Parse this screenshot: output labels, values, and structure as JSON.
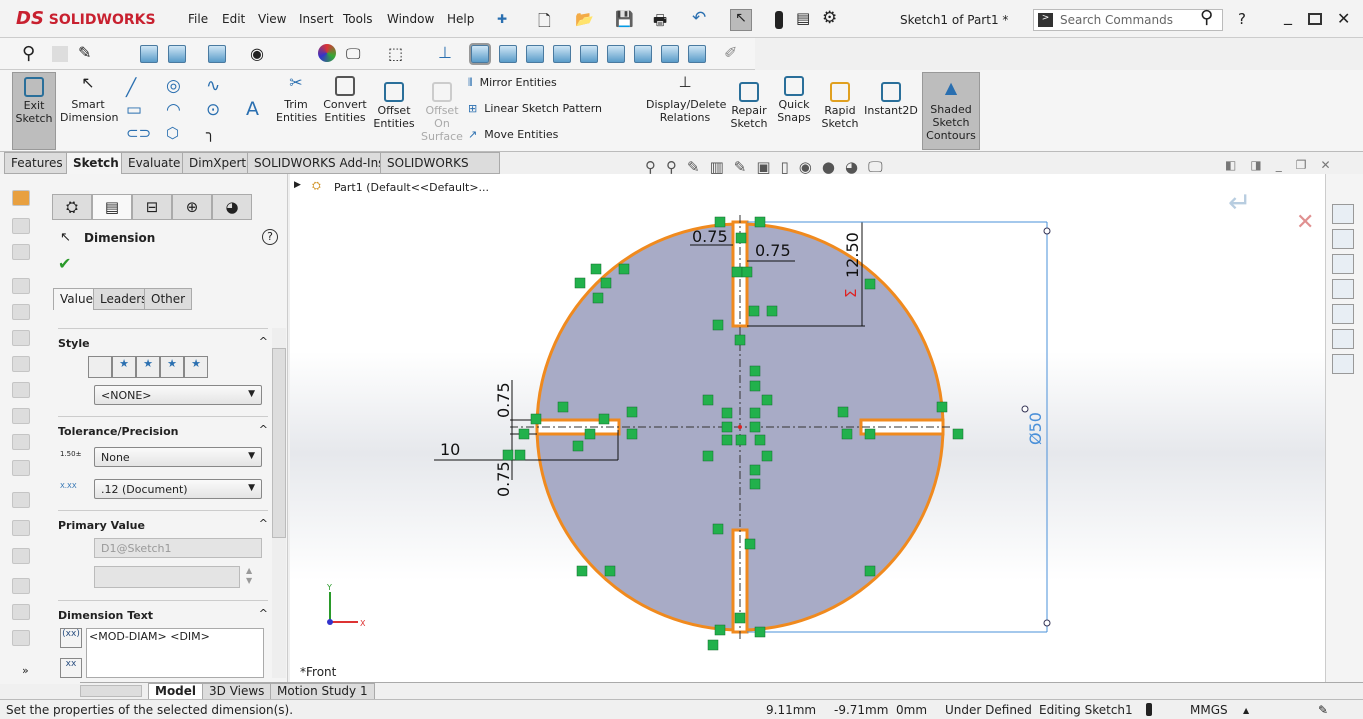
{
  "app": {
    "brand": "SOLIDWORKS",
    "title": "Sketch1 of Part1 *",
    "search_placeholder": "Search Commands"
  },
  "menu": [
    "File",
    "Edit",
    "View",
    "Insert",
    "Tools",
    "Window",
    "Help"
  ],
  "ribbon": {
    "exit_sketch": "Exit Sketch",
    "smart_dimension": "Smart Dimension",
    "trim_entities": "Trim Entities",
    "convert_entities": "Convert Entities",
    "offset_entities": "Offset Entities",
    "offset_on_surface": "Offset On Surface",
    "mirror_entities": "Mirror Entities",
    "linear_sketch_pattern": "Linear Sketch Pattern",
    "move_entities": "Move Entities",
    "display_delete_relations": "Display/Delete Relations",
    "repair_sketch": "Repair Sketch",
    "quick_snaps": "Quick Snaps",
    "rapid_sketch": "Rapid Sketch",
    "instant2d": "Instant2D",
    "shaded_sketch_contours": "Shaded Sketch Contours"
  },
  "command_tabs": [
    "Features",
    "Sketch",
    "Evaluate",
    "DimXpert",
    "SOLIDWORKS Add-Ins",
    "SOLIDWORKS MBD"
  ],
  "property_manager": {
    "title": "Dimension",
    "subtabs": [
      "Value",
      "Leaders",
      "Other"
    ],
    "style": {
      "label": "Style",
      "value": "<NONE>"
    },
    "tolerance": {
      "label": "Tolerance/Precision",
      "tolerance_value": "None",
      "precision_value": ".12 (Document)"
    },
    "primary": {
      "label": "Primary Value",
      "name": "D1@Sketch1",
      "value": ""
    },
    "dim_text": {
      "label": "Dimension Text",
      "value": "<MOD-DIAM> <DIM>"
    }
  },
  "tree": {
    "root": "Part1  (Default<<Default>..."
  },
  "sketch": {
    "dims": {
      "top_left": "0.75",
      "top_right": "0.75",
      "vertical": "12.50",
      "left_upper": "0.75",
      "left_lower": "0.75",
      "left_len": "10",
      "diameter": "Ø50"
    },
    "view_label": "*Front",
    "colors": {
      "outline": "#f08a1e",
      "fill": "#a8abc6",
      "dim": "#4a90d9",
      "relation": "#22b14c"
    }
  },
  "bottom_tabs": [
    "Model",
    "3D Views",
    "Motion Study 1"
  ],
  "status": {
    "message": "Set the properties of the selected dimension(s).",
    "x": "9.11mm",
    "y": "-9.71mm",
    "z": "0mm",
    "state": "Under Defined",
    "editing": "Editing Sketch1",
    "units": "MMGS"
  }
}
